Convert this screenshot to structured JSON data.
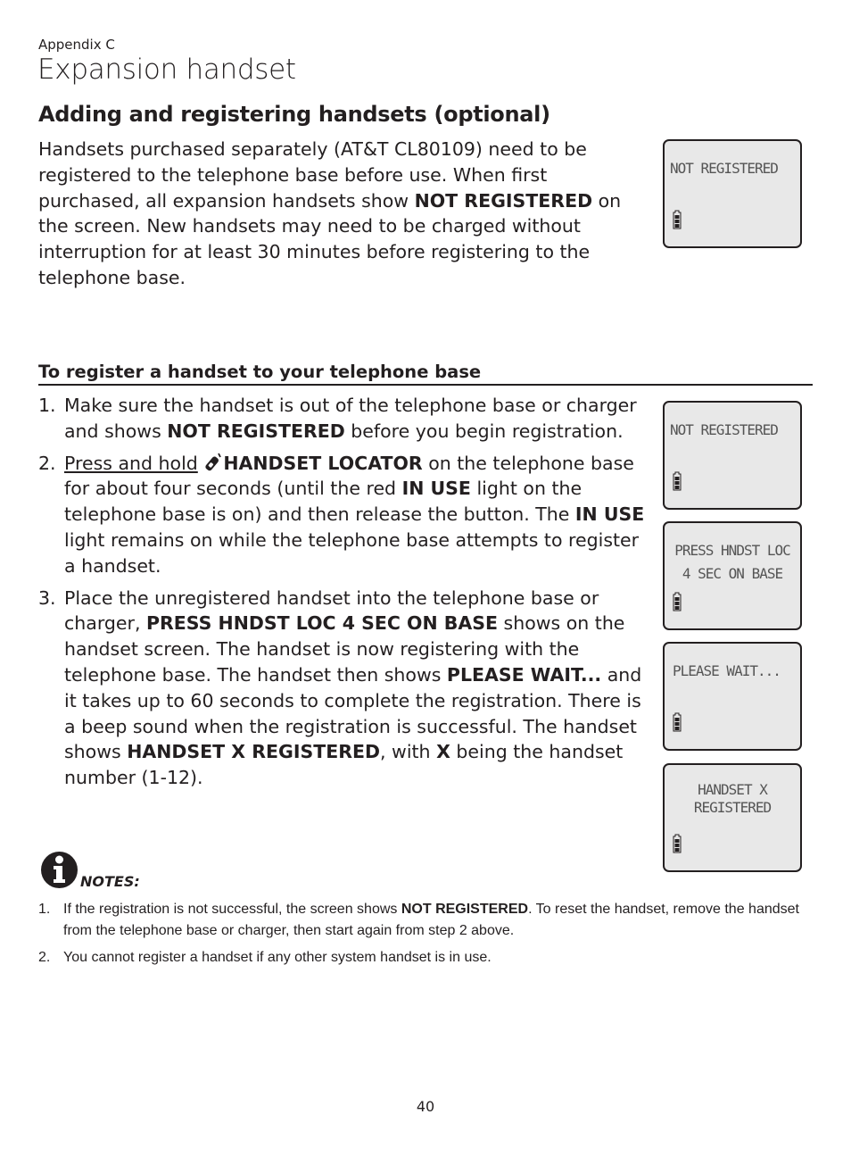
{
  "header": {
    "section": "Appendix C",
    "title": "Expansion handset"
  },
  "section": {
    "heading": "Adding and registering handsets (optional)",
    "intro": {
      "part1": "Handsets purchased separately (AT&T CL80109) need to be registered to the telephone base before use. When first purchased, all expansion handsets show ",
      "bold1": "NOT REGISTERED",
      "part2": " on the screen. New handsets may need to be charged without interruption for at least 30 minutes before registering to the telephone base."
    }
  },
  "procedure": {
    "heading": "To register a handset to your telephone base",
    "steps": [
      {
        "num": "1.",
        "t1": "Make sure the handset is out of the telephone base or charger and shows ",
        "b1": "NOT REGISTERED",
        "t2": " before you begin registration."
      },
      {
        "num": "2.",
        "link": "Press and hold",
        "icon": "handset-locator-icon",
        "b1": "HANDSET LOCATOR",
        "t1": " on the telephone base for about four seconds (until the red ",
        "b2": "IN USE",
        "t2": " light on the telephone base is on) and then release the button. The ",
        "b3": "IN USE",
        "t3": " light remains on while the telephone base attempts to register a handset."
      },
      {
        "num": "3.",
        "t1": "Place the unregistered handset into the telephone base or charger, ",
        "b1": "PRESS HNDST LOC 4 SEC ON BASE",
        "t2": " shows on the handset screen. The handset is now registering with the telephone base. The handset then shows ",
        "b2": "PLEASE WAIT...",
        "t3": " and it takes up to 60 seconds to complete the registration. There is a beep sound when the registration is successful. The handset shows ",
        "b3": "HANDSET X REGISTERED",
        "t4": ", with ",
        "b4": "X",
        "t5": " being the handset number (1-12)."
      }
    ]
  },
  "screens": [
    {
      "line1": "NOT REGISTERED",
      "line2": "",
      "battery": "full"
    },
    {
      "line1": "NOT REGISTERED",
      "line2": "",
      "battery": "full"
    },
    {
      "line1": "PRESS HNDST LOC",
      "line2": "4 SEC ON BASE",
      "battery": "full"
    },
    {
      "line1": "PLEASE WAIT...",
      "line2": "",
      "battery": "full"
    },
    {
      "line1": "HANDSET X",
      "line2": "REGISTERED",
      "battery": "full"
    }
  ],
  "notes": {
    "label": "NOTES:",
    "items": [
      {
        "num": "1.",
        "t1": "If the registration is not successful, the screen shows ",
        "b1": "NOT REGISTERED",
        "t2": ". To reset the handset, remove the handset from the telephone base or charger, then start again from step 2 above."
      },
      {
        "num": "2.",
        "t1": "You cannot register a handset if any other system handset is in use."
      }
    ]
  },
  "footer": {
    "page_number": "40"
  }
}
